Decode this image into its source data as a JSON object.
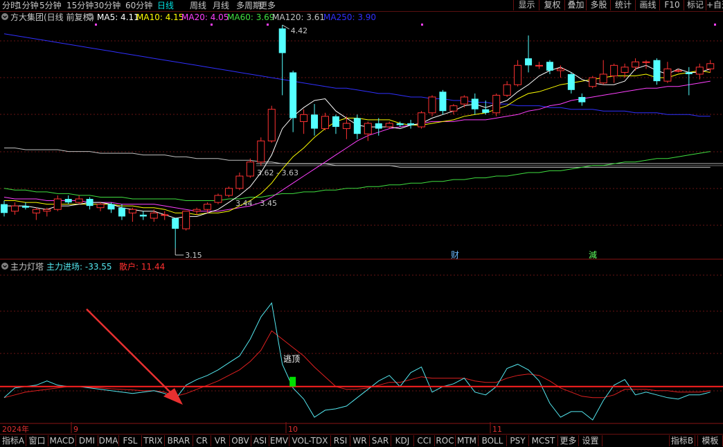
{
  "period_tabs": [
    "分时",
    "1分钟",
    "5分钟",
    "15分钟",
    "30分钟",
    "60分钟",
    "日线",
    "周线",
    "月线",
    "多周期",
    "更多"
  ],
  "active_period": "日线",
  "right_buttons": [
    "显示",
    "复权",
    "叠加",
    "多股",
    "统计",
    "画线",
    "F10",
    "标记",
    "+自选"
  ],
  "stock_title": "方大集团(日线 前复权)",
  "ma_legend": [
    {
      "label": "MA5: 4.11",
      "color": "#ffffff"
    },
    {
      "label": "MA10: 4.15",
      "color": "#ffff00"
    },
    {
      "label": "MA20: 4.05",
      "color": "#ff40ff"
    },
    {
      "label": "MA60: 3.69",
      "color": "#40e040"
    },
    {
      "label": "MA120: 3.61",
      "color": "#c0c0c0"
    },
    {
      "label": "MA250: 3.90",
      "color": "#3030ff"
    }
  ],
  "price_annotations": {
    "high": "4.42",
    "low": "3.15",
    "range1": "3.62 - 3.63",
    "range2": "3.44 - 3.45"
  },
  "event_markers": {
    "cai": "财",
    "jian": "減"
  },
  "indicator": {
    "name": "主力灯塔",
    "line1_label": "主力进场: -33.55",
    "line2_label": "散户: 11.44",
    "signal_label": "逃顶"
  },
  "date_labels": {
    "year": "2024年",
    "m9": "9",
    "m10": "10",
    "m11": "11"
  },
  "bottom_tabs": [
    "指标A",
    "窗口",
    "MACD",
    "DMI",
    "DMA",
    "FSL",
    "TRIX",
    "BRAR",
    "CR",
    "VR",
    "OBV",
    "ASI",
    "EMV",
    "VOL-TDX",
    "RSI",
    "WR",
    "SAR",
    "KDJ",
    "CCI",
    "ROC",
    "MTM",
    "BOLL",
    "PSY",
    "MCST",
    "更多",
    "设置"
  ],
  "bottom_right_tabs": [
    "指标B",
    "模板"
  ],
  "colors": {
    "up": "#ff3232",
    "down": "#54ffff",
    "ma5": "#ffffff",
    "ma10": "#ffff00",
    "ma20": "#ff40ff",
    "ma60": "#40e040",
    "ma120": "#c0c0c0",
    "ma250": "#3030ff",
    "zero_line": "#ff2020",
    "ind_cyan": "#54e8f0",
    "ind_red": "#e02020"
  },
  "chart_data": {
    "type": "candlestick",
    "price_range": [
      3.15,
      4.42
    ],
    "candles": [
      {
        "o": 3.4,
        "h": 3.42,
        "l": 3.33,
        "c": 3.35
      },
      {
        "o": 3.36,
        "h": 3.41,
        "l": 3.34,
        "c": 3.39
      },
      {
        "o": 3.39,
        "h": 3.41,
        "l": 3.37,
        "c": 3.38
      },
      {
        "o": 3.35,
        "h": 3.38,
        "l": 3.31,
        "c": 3.37
      },
      {
        "o": 3.36,
        "h": 3.38,
        "l": 3.33,
        "c": 3.37
      },
      {
        "o": 3.37,
        "h": 3.45,
        "l": 3.36,
        "c": 3.43
      },
      {
        "o": 3.43,
        "h": 3.45,
        "l": 3.4,
        "c": 3.41
      },
      {
        "o": 3.41,
        "h": 3.45,
        "l": 3.4,
        "c": 3.43
      },
      {
        "o": 3.43,
        "h": 3.44,
        "l": 3.37,
        "c": 3.39
      },
      {
        "o": 3.38,
        "h": 3.41,
        "l": 3.36,
        "c": 3.4
      },
      {
        "o": 3.4,
        "h": 3.41,
        "l": 3.35,
        "c": 3.37
      },
      {
        "o": 3.38,
        "h": 3.4,
        "l": 3.31,
        "c": 3.33
      },
      {
        "o": 3.35,
        "h": 3.38,
        "l": 3.3,
        "c": 3.37
      },
      {
        "o": 3.34,
        "h": 3.36,
        "l": 3.31,
        "c": 3.33
      },
      {
        "o": 3.32,
        "h": 3.37,
        "l": 3.3,
        "c": 3.35
      },
      {
        "o": 3.34,
        "h": 3.36,
        "l": 3.31,
        "c": 3.34
      },
      {
        "o": 3.32,
        "h": 3.31,
        "l": 3.15,
        "c": 3.26
      },
      {
        "o": 3.26,
        "h": 3.36,
        "l": 3.25,
        "c": 3.36
      },
      {
        "o": 3.36,
        "h": 3.38,
        "l": 3.34,
        "c": 3.37
      },
      {
        "o": 3.37,
        "h": 3.41,
        "l": 3.35,
        "c": 3.4
      },
      {
        "o": 3.41,
        "h": 3.46,
        "l": 3.4,
        "c": 3.45
      },
      {
        "o": 3.45,
        "h": 3.5,
        "l": 3.44,
        "c": 3.49
      },
      {
        "o": 3.49,
        "h": 3.58,
        "l": 3.48,
        "c": 3.56
      },
      {
        "o": 3.56,
        "h": 3.66,
        "l": 3.55,
        "c": 3.64
      },
      {
        "o": 3.64,
        "h": 3.78,
        "l": 3.62,
        "c": 3.76
      },
      {
        "o": 3.76,
        "h": 3.96,
        "l": 3.75,
        "c": 3.94
      },
      {
        "o": 4.4,
        "h": 4.42,
        "l": 4.02,
        "c": 4.26
      },
      {
        "o": 4.15,
        "h": 4.16,
        "l": 3.81,
        "c": 3.89
      },
      {
        "o": 3.87,
        "h": 3.94,
        "l": 3.8,
        "c": 3.91
      },
      {
        "o": 3.91,
        "h": 3.97,
        "l": 3.79,
        "c": 3.83
      },
      {
        "o": 3.83,
        "h": 3.92,
        "l": 3.82,
        "c": 3.9
      },
      {
        "o": 3.9,
        "h": 3.91,
        "l": 3.8,
        "c": 3.84
      },
      {
        "o": 3.83,
        "h": 3.9,
        "l": 3.77,
        "c": 3.86
      },
      {
        "o": 3.89,
        "h": 3.91,
        "l": 3.77,
        "c": 3.8
      },
      {
        "o": 3.8,
        "h": 3.87,
        "l": 3.76,
        "c": 3.86
      },
      {
        "o": 3.86,
        "h": 3.89,
        "l": 3.79,
        "c": 3.83
      },
      {
        "o": 3.84,
        "h": 3.87,
        "l": 3.83,
        "c": 3.86
      },
      {
        "o": 3.86,
        "h": 3.87,
        "l": 3.84,
        "c": 3.85
      },
      {
        "o": 3.86,
        "h": 3.88,
        "l": 3.83,
        "c": 3.85
      },
      {
        "o": 3.84,
        "h": 3.93,
        "l": 3.83,
        "c": 3.92
      },
      {
        "o": 3.92,
        "h": 4.02,
        "l": 3.9,
        "c": 4.01
      },
      {
        "o": 4.04,
        "h": 4.05,
        "l": 3.91,
        "c": 3.93
      },
      {
        "o": 3.93,
        "h": 3.97,
        "l": 3.91,
        "c": 3.96
      },
      {
        "o": 3.97,
        "h": 4.02,
        "l": 3.95,
        "c": 4.01
      },
      {
        "o": 4.0,
        "h": 4.03,
        "l": 3.91,
        "c": 3.94
      },
      {
        "o": 3.94,
        "h": 3.99,
        "l": 3.91,
        "c": 3.92
      },
      {
        "o": 3.92,
        "h": 4.03,
        "l": 3.9,
        "c": 4.02
      },
      {
        "o": 4.02,
        "h": 4.1,
        "l": 4.01,
        "c": 4.08
      },
      {
        "o": 4.08,
        "h": 4.22,
        "l": 4.07,
        "c": 4.19
      },
      {
        "o": 4.23,
        "h": 4.36,
        "l": 4.15,
        "c": 4.19
      },
      {
        "o": 4.19,
        "h": 4.21,
        "l": 4.17,
        "c": 4.19
      },
      {
        "o": 4.21,
        "h": 4.22,
        "l": 4.14,
        "c": 4.16
      },
      {
        "o": 4.16,
        "h": 4.19,
        "l": 4.12,
        "c": 4.17
      },
      {
        "o": 4.14,
        "h": 4.15,
        "l": 4.03,
        "c": 4.05
      },
      {
        "o": 4.01,
        "h": 4.03,
        "l": 3.96,
        "c": 3.98
      },
      {
        "o": 4.07,
        "h": 4.13,
        "l": 4.06,
        "c": 4.12
      },
      {
        "o": 4.09,
        "h": 4.22,
        "l": 4.08,
        "c": 4.14
      },
      {
        "o": 4.13,
        "h": 4.2,
        "l": 4.09,
        "c": 4.19
      },
      {
        "o": 4.15,
        "h": 4.2,
        "l": 4.12,
        "c": 4.18
      },
      {
        "o": 4.18,
        "h": 4.23,
        "l": 4.16,
        "c": 4.21
      },
      {
        "o": 4.21,
        "h": 4.22,
        "l": 4.17,
        "c": 4.21
      },
      {
        "o": 4.22,
        "h": 4.23,
        "l": 4.08,
        "c": 4.1
      },
      {
        "o": 4.1,
        "h": 4.21,
        "l": 4.09,
        "c": 4.17
      },
      {
        "o": 4.16,
        "h": 4.17,
        "l": 4.15,
        "c": 4.16
      },
      {
        "o": 4.15,
        "h": 4.18,
        "l": 4.02,
        "c": 4.14
      },
      {
        "o": 4.14,
        "h": 4.2,
        "l": 4.11,
        "c": 4.18
      },
      {
        "o": 4.17,
        "h": 4.22,
        "l": 4.15,
        "c": 4.2
      }
    ],
    "ma5": [
      3.39,
      3.39,
      3.39,
      3.38,
      3.37,
      3.39,
      3.39,
      3.4,
      3.41,
      3.41,
      3.4,
      3.38,
      3.37,
      3.36,
      3.36,
      3.34,
      3.32,
      3.33,
      3.33,
      3.35,
      3.37,
      3.41,
      3.45,
      3.5,
      3.58,
      3.68,
      3.83,
      3.9,
      3.95,
      3.99,
      4.0,
      3.93,
      3.89,
      3.85,
      3.84,
      3.84,
      3.84,
      3.83,
      3.85,
      3.86,
      3.89,
      3.91,
      3.93,
      3.96,
      3.97,
      3.95,
      3.97,
      3.99,
      4.04,
      4.08,
      4.13,
      4.16,
      4.18,
      4.15,
      4.11,
      4.09,
      4.08,
      4.08,
      4.1,
      4.17,
      4.19,
      4.16,
      4.14,
      4.17,
      4.15,
      4.15,
      4.17
    ],
    "ma10": [
      3.42,
      3.42,
      3.41,
      3.41,
      3.4,
      3.4,
      3.4,
      3.4,
      3.4,
      3.4,
      3.4,
      3.39,
      3.39,
      3.38,
      3.38,
      3.37,
      3.35,
      3.35,
      3.34,
      3.35,
      3.35,
      3.36,
      3.39,
      3.42,
      3.46,
      3.52,
      3.6,
      3.67,
      3.72,
      3.78,
      3.83,
      3.87,
      3.89,
      3.89,
      3.88,
      3.88,
      3.88,
      3.86,
      3.85,
      3.85,
      3.86,
      3.87,
      3.88,
      3.9,
      3.91,
      3.92,
      3.94,
      3.96,
      4.0,
      4.03,
      4.04,
      4.06,
      4.08,
      4.09,
      4.1,
      4.11,
      4.12,
      4.13,
      4.13,
      4.13,
      4.14,
      4.12,
      4.12,
      4.14,
      4.15,
      4.16,
      4.15
    ],
    "ma20": [
      3.44,
      3.43,
      3.43,
      3.43,
      3.42,
      3.42,
      3.42,
      3.42,
      3.41,
      3.41,
      3.41,
      3.4,
      3.4,
      3.4,
      3.4,
      3.39,
      3.38,
      3.37,
      3.36,
      3.36,
      3.36,
      3.37,
      3.38,
      3.39,
      3.41,
      3.44,
      3.48,
      3.52,
      3.56,
      3.6,
      3.64,
      3.68,
      3.72,
      3.76,
      3.79,
      3.81,
      3.83,
      3.84,
      3.85,
      3.86,
      3.87,
      3.87,
      3.87,
      3.88,
      3.88,
      3.88,
      3.89,
      3.9,
      3.91,
      3.93,
      3.94,
      3.96,
      3.97,
      3.99,
      4.0,
      4.01,
      4.02,
      4.03,
      4.04,
      4.05,
      4.06,
      4.06,
      4.07,
      4.07,
      4.08,
      4.09,
      4.1
    ],
    "ma60": [
      3.49,
      3.48,
      3.48,
      3.47,
      3.47,
      3.46,
      3.46,
      3.45,
      3.45,
      3.44,
      3.44,
      3.44,
      3.43,
      3.43,
      3.43,
      3.43,
      3.43,
      3.42,
      3.42,
      3.42,
      3.42,
      3.43,
      3.43,
      3.44,
      3.44,
      3.45,
      3.46,
      3.46,
      3.47,
      3.47,
      3.48,
      3.48,
      3.49,
      3.49,
      3.5,
      3.5,
      3.51,
      3.51,
      3.52,
      3.52,
      3.53,
      3.53,
      3.54,
      3.54,
      3.55,
      3.55,
      3.56,
      3.56,
      3.57,
      3.58,
      3.58,
      3.59,
      3.59,
      3.6,
      3.61,
      3.62,
      3.62,
      3.63,
      3.64,
      3.64,
      3.65,
      3.66,
      3.66,
      3.67,
      3.68,
      3.69,
      3.7
    ],
    "ma120": [
      3.72,
      3.72,
      3.71,
      3.71,
      3.71,
      3.71,
      3.7,
      3.7,
      3.7,
      3.69,
      3.69,
      3.69,
      3.69,
      3.68,
      3.68,
      3.68,
      3.67,
      3.67,
      3.66,
      3.66,
      3.66,
      3.65,
      3.65,
      3.65,
      3.64,
      3.64,
      3.63,
      3.63,
      3.63,
      3.63,
      3.63,
      3.62,
      3.62,
      3.62,
      3.62,
      3.62,
      3.62,
      3.61,
      3.61,
      3.61,
      3.61,
      3.61,
      3.61,
      3.61,
      3.61,
      3.61,
      3.61,
      3.61,
      3.61,
      3.61,
      3.61,
      3.61,
      3.61,
      3.61,
      3.61,
      3.61,
      3.61,
      3.61,
      3.61,
      3.61,
      3.61,
      3.61,
      3.61,
      3.61,
      3.61,
      3.61,
      3.61
    ],
    "ma250": [
      4.37,
      4.36,
      4.35,
      4.34,
      4.33,
      4.32,
      4.31,
      4.3,
      4.29,
      4.28,
      4.27,
      4.26,
      4.25,
      4.24,
      4.23,
      4.22,
      4.21,
      4.2,
      4.19,
      4.18,
      4.17,
      4.16,
      4.15,
      4.14,
      4.13,
      4.12,
      4.11,
      4.1,
      4.09,
      4.08,
      4.07,
      4.06,
      4.06,
      4.05,
      4.04,
      4.03,
      4.03,
      4.02,
      4.01,
      4.01,
      4.0,
      4.0,
      3.99,
      3.99,
      3.98,
      3.98,
      3.97,
      3.97,
      3.96,
      3.96,
      3.96,
      3.95,
      3.95,
      3.94,
      3.94,
      3.94,
      3.93,
      3.93,
      3.93,
      3.92,
      3.92,
      3.92,
      3.91,
      3.91,
      3.91,
      3.9,
      3.9
    ],
    "indicator_range": [
      -120,
      400
    ],
    "ind_cyan": [
      -40,
      -5,
      0,
      5,
      20,
      5,
      0,
      0,
      -5,
      -10,
      -15,
      -20,
      -25,
      -20,
      -15,
      -25,
      -45,
      5,
      25,
      40,
      60,
      85,
      110,
      170,
      250,
      300,
      80,
      -5,
      -45,
      -110,
      -85,
      -80,
      -70,
      -40,
      -10,
      20,
      40,
      0,
      50,
      70,
      -20,
      0,
      10,
      30,
      -20,
      -30,
      0,
      65,
      80,
      60,
      20,
      -60,
      -110,
      -90,
      -90,
      -120,
      -50,
      5,
      25,
      -30,
      -20,
      -30,
      -40,
      -45,
      -30,
      -30,
      -20
    ],
    "ind_red": [
      -40,
      -30,
      -20,
      -15,
      -10,
      -5,
      0,
      0,
      -3,
      -5,
      -8,
      -10,
      -12,
      -15,
      -15,
      -20,
      -35,
      -25,
      -10,
      5,
      20,
      40,
      60,
      90,
      130,
      200,
      170,
      140,
      110,
      70,
      35,
      0,
      -10,
      -10,
      -5,
      5,
      15,
      15,
      25,
      35,
      30,
      30,
      30,
      30,
      20,
      15,
      15,
      30,
      40,
      45,
      40,
      20,
      -5,
      -20,
      -35,
      -40,
      -40,
      -30,
      -10,
      -10,
      -10,
      -15,
      -15,
      -20,
      -20,
      -20,
      -15
    ],
    "signal_bar_index": 26,
    "zero": 0
  }
}
